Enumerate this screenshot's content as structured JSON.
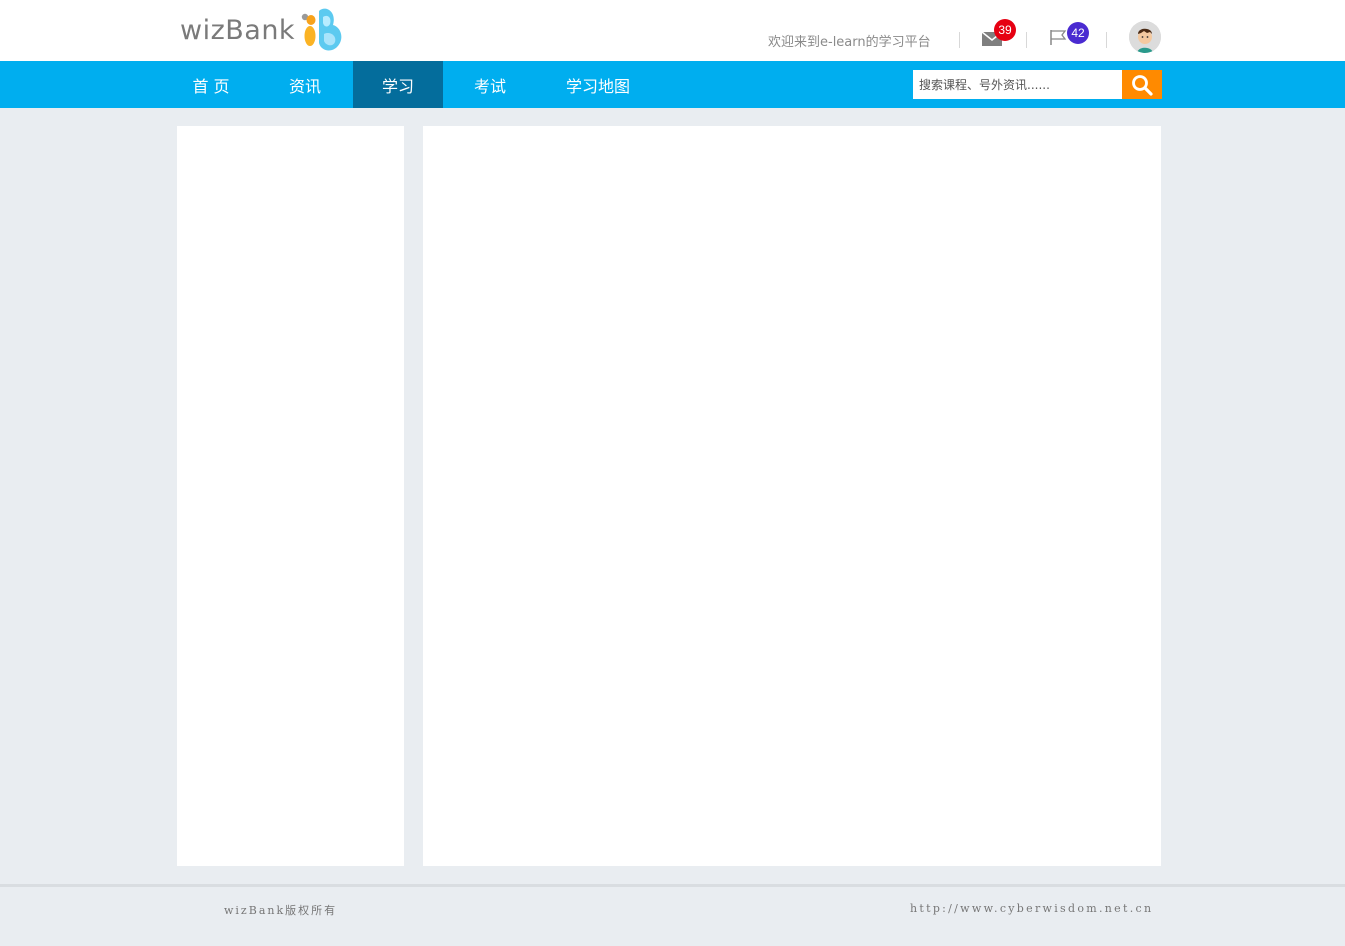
{
  "header": {
    "logo_text": "wizBank",
    "welcome": "欢迎来到e-learn的学习平台",
    "messages_count": "39",
    "flags_count": "42",
    "colors": {
      "message_badge": "#e60012",
      "flag_badge": "#4a2bd1"
    }
  },
  "nav": {
    "items": [
      {
        "label": "首 页"
      },
      {
        "label": "资讯"
      },
      {
        "label": "学习"
      },
      {
        "label": "考试"
      },
      {
        "label": "学习地图"
      }
    ],
    "active": "学习",
    "colors": {
      "bar": "#00aeef",
      "active": "#046d9c"
    }
  },
  "search": {
    "placeholder": "搜索课程、号外资讯......",
    "icon": "search-icon",
    "button_color": "#ff8a00"
  },
  "footer": {
    "copyright": "wizBank版权所有",
    "url": "http://www.cyberwisdom.net.cn"
  }
}
